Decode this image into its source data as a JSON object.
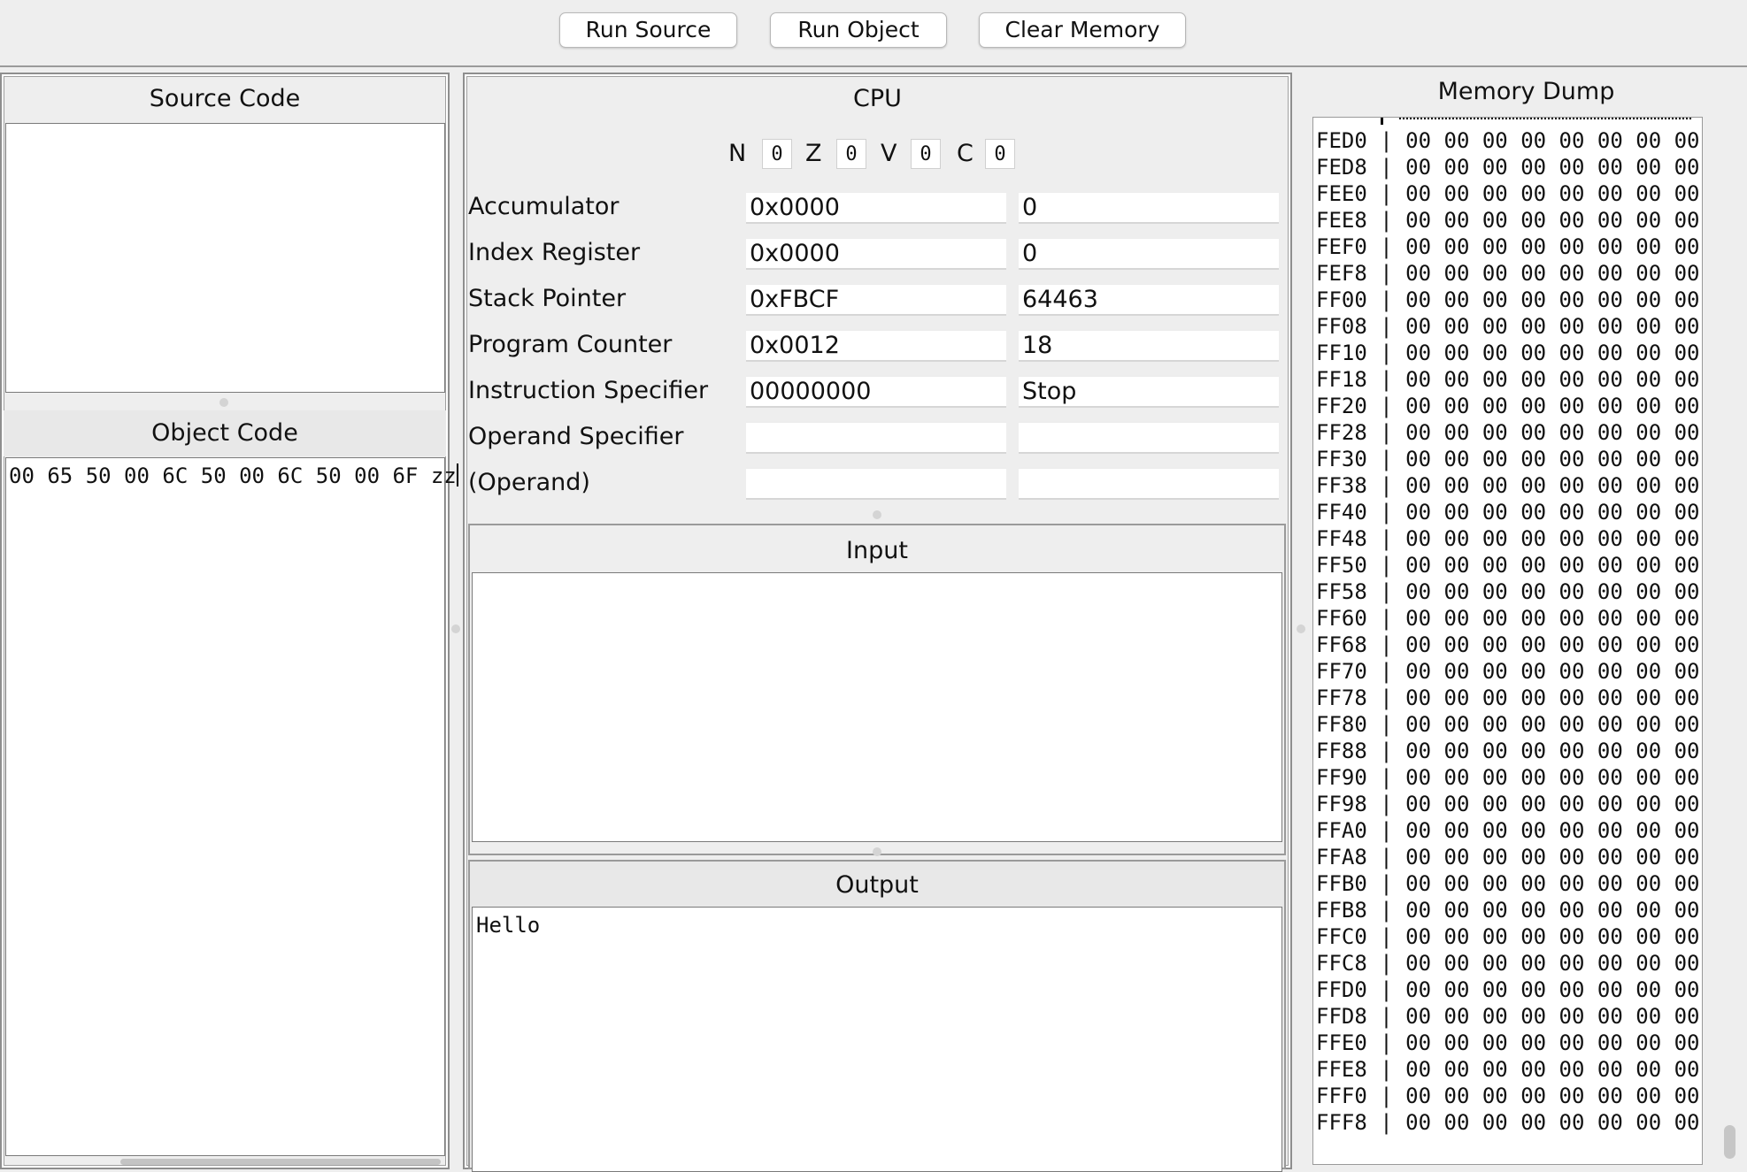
{
  "toolbar": {
    "run_source": "Run Source",
    "run_object": "Run Object",
    "clear_memory": "Clear Memory"
  },
  "source_pane": {
    "title": "Source Code",
    "text": ""
  },
  "object_pane": {
    "title": "Object Code",
    "text": "00 65 50 00 6C 50 00 6C 50 00 6F zz"
  },
  "cpu": {
    "title": "CPU",
    "flags": [
      {
        "name": "N",
        "value": "0"
      },
      {
        "name": "Z",
        "value": "0"
      },
      {
        "name": "V",
        "value": "0"
      },
      {
        "name": "C",
        "value": "0"
      }
    ],
    "registers": [
      {
        "label": "Accumulator",
        "hex": "0x0000",
        "dec": "0"
      },
      {
        "label": "Index Register",
        "hex": "0x0000",
        "dec": "0"
      },
      {
        "label": "Stack Pointer",
        "hex": "0xFBCF",
        "dec": "64463"
      },
      {
        "label": "Program Counter",
        "hex": "0x0012",
        "dec": "18"
      },
      {
        "label": "Instruction Specifier",
        "hex": "00000000",
        "dec": "Stop"
      },
      {
        "label": "Operand Specifier",
        "hex": "",
        "dec": ""
      },
      {
        "label": "(Operand)",
        "hex": "",
        "dec": ""
      }
    ]
  },
  "input_pane": {
    "title": "Input",
    "text": ""
  },
  "output_pane": {
    "title": "Output",
    "text": "Hello"
  },
  "memory_dump": {
    "title": "Memory Dump",
    "rows": [
      {
        "addr": "FED0",
        "bytes": "00 00 00 00 00 00 00 00"
      },
      {
        "addr": "FED8",
        "bytes": "00 00 00 00 00 00 00 00"
      },
      {
        "addr": "FEE0",
        "bytes": "00 00 00 00 00 00 00 00"
      },
      {
        "addr": "FEE8",
        "bytes": "00 00 00 00 00 00 00 00"
      },
      {
        "addr": "FEF0",
        "bytes": "00 00 00 00 00 00 00 00"
      },
      {
        "addr": "FEF8",
        "bytes": "00 00 00 00 00 00 00 00"
      },
      {
        "addr": "FF00",
        "bytes": "00 00 00 00 00 00 00 00"
      },
      {
        "addr": "FF08",
        "bytes": "00 00 00 00 00 00 00 00"
      },
      {
        "addr": "FF10",
        "bytes": "00 00 00 00 00 00 00 00"
      },
      {
        "addr": "FF18",
        "bytes": "00 00 00 00 00 00 00 00"
      },
      {
        "addr": "FF20",
        "bytes": "00 00 00 00 00 00 00 00"
      },
      {
        "addr": "FF28",
        "bytes": "00 00 00 00 00 00 00 00"
      },
      {
        "addr": "FF30",
        "bytes": "00 00 00 00 00 00 00 00"
      },
      {
        "addr": "FF38",
        "bytes": "00 00 00 00 00 00 00 00"
      },
      {
        "addr": "FF40",
        "bytes": "00 00 00 00 00 00 00 00"
      },
      {
        "addr": "FF48",
        "bytes": "00 00 00 00 00 00 00 00"
      },
      {
        "addr": "FF50",
        "bytes": "00 00 00 00 00 00 00 00"
      },
      {
        "addr": "FF58",
        "bytes": "00 00 00 00 00 00 00 00"
      },
      {
        "addr": "FF60",
        "bytes": "00 00 00 00 00 00 00 00"
      },
      {
        "addr": "FF68",
        "bytes": "00 00 00 00 00 00 00 00"
      },
      {
        "addr": "FF70",
        "bytes": "00 00 00 00 00 00 00 00"
      },
      {
        "addr": "FF78",
        "bytes": "00 00 00 00 00 00 00 00"
      },
      {
        "addr": "FF80",
        "bytes": "00 00 00 00 00 00 00 00"
      },
      {
        "addr": "FF88",
        "bytes": "00 00 00 00 00 00 00 00"
      },
      {
        "addr": "FF90",
        "bytes": "00 00 00 00 00 00 00 00"
      },
      {
        "addr": "FF98",
        "bytes": "00 00 00 00 00 00 00 00"
      },
      {
        "addr": "FFA0",
        "bytes": "00 00 00 00 00 00 00 00"
      },
      {
        "addr": "FFA8",
        "bytes": "00 00 00 00 00 00 00 00"
      },
      {
        "addr": "FFB0",
        "bytes": "00 00 00 00 00 00 00 00"
      },
      {
        "addr": "FFB8",
        "bytes": "00 00 00 00 00 00 00 00"
      },
      {
        "addr": "FFC0",
        "bytes": "00 00 00 00 00 00 00 00"
      },
      {
        "addr": "FFC8",
        "bytes": "00 00 00 00 00 00 00 00"
      },
      {
        "addr": "FFD0",
        "bytes": "00 00 00 00 00 00 00 00"
      },
      {
        "addr": "FFD8",
        "bytes": "00 00 00 00 00 00 00 00"
      },
      {
        "addr": "FFE0",
        "bytes": "00 00 00 00 00 00 00 00"
      },
      {
        "addr": "FFE8",
        "bytes": "00 00 00 00 00 00 00 00"
      },
      {
        "addr": "FFF0",
        "bytes": "00 00 00 00 00 00 00 00"
      },
      {
        "addr": "FFF8",
        "bytes": "00 00 00 00 00 00 00 00"
      }
    ]
  }
}
